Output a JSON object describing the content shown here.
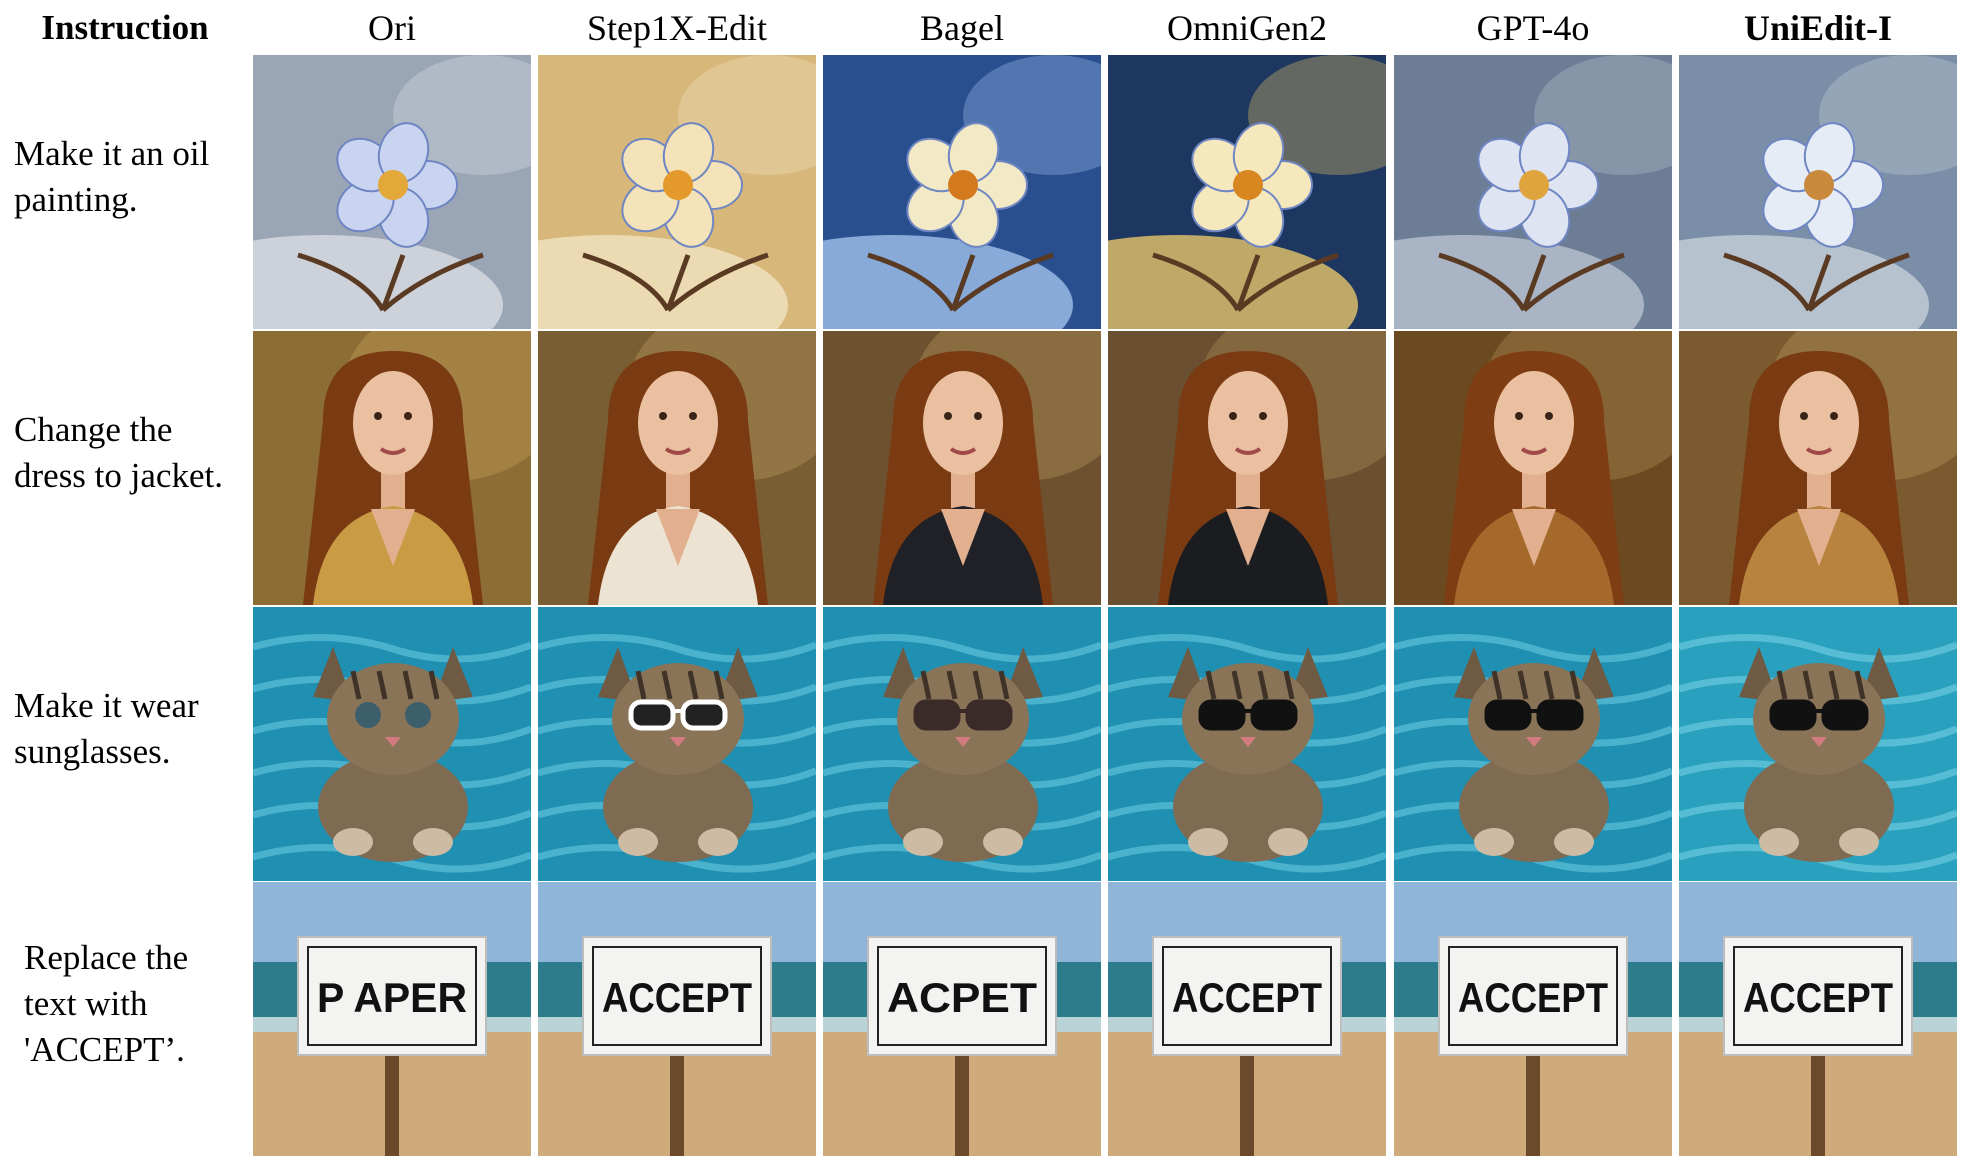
{
  "columns": {
    "instruction": "Instruction",
    "methods": [
      "Ori",
      "Step1X-Edit",
      "Bagel",
      "OmniGen2",
      "GPT-4o",
      "UniEdit-I"
    ],
    "highlighted": "UniEdit-I"
  },
  "rows": [
    {
      "instruction_lines": [
        "Make it an oil",
        "painting."
      ],
      "subject": "flower",
      "palettes": [
        {
          "bg": "#9aa6b5",
          "bg2": "#d9dde4",
          "petal": "#c9d4f0",
          "center": "#e2a83a"
        },
        {
          "bg": "#d7b77a",
          "bg2": "#f0e2c0",
          "petal": "#f4e3b8",
          "center": "#e39a2a"
        },
        {
          "bg": "#2a4f8f",
          "bg2": "#9fc1ea",
          "petal": "#f2e9c6",
          "center": "#d37a1f"
        },
        {
          "bg": "#1d3760",
          "bg2": "#e9c56b",
          "petal": "#f5e8bd",
          "center": "#d8861f"
        },
        {
          "bg": "#6c7d95",
          "bg2": "#b9c3cf",
          "petal": "#dfe4f2",
          "center": "#e0a43e"
        },
        {
          "bg": "#7b8ea7",
          "bg2": "#c7d0da",
          "petal": "#e6ecf6",
          "center": "#c98a3d"
        }
      ]
    },
    {
      "instruction_lines": [
        "Change the",
        "dress to jacket."
      ],
      "subject": "portrait",
      "palettes": [
        {
          "bg": "#8d6d36",
          "bg2": "#b8954f",
          "cloth": "#c89b44",
          "hair": "#7a3a12"
        },
        {
          "bg": "#7a5e33",
          "bg2": "#a88c55",
          "cloth": "#ece3d2",
          "hair": "#7a3a12"
        },
        {
          "bg": "#6e5230",
          "bg2": "#a3864f",
          "cloth": "#1f2126",
          "hair": "#7a3a12"
        },
        {
          "bg": "#6a4f30",
          "bg2": "#9c7f4c",
          "cloth": "#1b1c20",
          "hair": "#7a3a12"
        },
        {
          "bg": "#6b4a22",
          "bg2": "#a27c45",
          "cloth": "#a5692b",
          "hair": "#7e3d12"
        },
        {
          "bg": "#7a5a2e",
          "bg2": "#a88a52",
          "cloth": "#b7833f",
          "hair": "#7a3a12"
        }
      ]
    },
    {
      "instruction_lines": [
        "Make it wear",
        "sunglasses."
      ],
      "subject": "kitten",
      "palettes": [
        {
          "bg": "#1f8fb2",
          "bg2": "#6fd0e3",
          "glasses": "none"
        },
        {
          "bg": "#1f8fb2",
          "bg2": "#6fd0e3",
          "glasses": "#ffffff"
        },
        {
          "bg": "#1f8fb2",
          "bg2": "#6fd0e3",
          "glasses": "#3a2a28"
        },
        {
          "bg": "#1f8fb2",
          "bg2": "#6fd0e3",
          "glasses": "#111111"
        },
        {
          "bg": "#1f8fb2",
          "bg2": "#6fd0e3",
          "glasses": "#111111"
        },
        {
          "bg": "#2aa0bf",
          "bg2": "#7ad6e6",
          "glasses": "#111111"
        }
      ]
    },
    {
      "instruction_lines": [
        "Replace the",
        "text with",
        "'ACCEPT’."
      ],
      "subject": "sign",
      "palettes": [
        {
          "sign_text": "P APER"
        },
        {
          "sign_text": "ACCEPT"
        },
        {
          "sign_text": "ACPET"
        },
        {
          "sign_text": "ACCEPT"
        },
        {
          "sign_text": "ACCEPT"
        },
        {
          "sign_text": "ACCEPT"
        }
      ]
    }
  ]
}
